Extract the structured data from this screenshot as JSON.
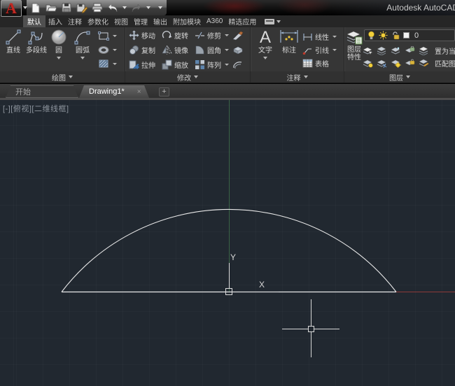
{
  "window": {
    "title": "Autodesk AutoCAD"
  },
  "ribbon_tabs": [
    {
      "label": "默认",
      "active": true
    },
    {
      "label": "插入"
    },
    {
      "label": "注释"
    },
    {
      "label": "参数化"
    },
    {
      "label": "视图"
    },
    {
      "label": "管理"
    },
    {
      "label": "输出"
    },
    {
      "label": "附加模块"
    },
    {
      "label": "A360"
    },
    {
      "label": "精选应用"
    }
  ],
  "draw_panel": {
    "label": "绘图",
    "line": "直线",
    "polyline": "多段线",
    "circle": "圆",
    "arc": "圆弧"
  },
  "modify_panel": {
    "label": "修改",
    "move": "移动",
    "rotate": "旋转",
    "trim": "修剪",
    "copy": "复制",
    "mirror": "镜像",
    "fillet": "圆角",
    "stretch": "拉伸",
    "scale": "缩放",
    "array": "阵列"
  },
  "annotate_panel": {
    "label": "注释",
    "text": "文字",
    "dimension": "标注",
    "linear": "线性",
    "leader": "引线",
    "table": "表格"
  },
  "layers_panel": {
    "label": "图层",
    "properties_line1": "图层",
    "properties_line2": "特性",
    "current_layer": "0",
    "set_current": "置为当前",
    "match_layer": "匹配图层"
  },
  "file_tabs": {
    "start": "开始",
    "drawing": "Drawing1*",
    "close": "×",
    "new_tab": "+"
  },
  "canvas": {
    "viewport_label": "[-][俯视][二维线框]",
    "x_axis_label": "X",
    "y_axis_label": "Y"
  },
  "colors": {
    "canvas_bg": "#212830",
    "x_axis": "#8e3a3a",
    "y_axis": "#3a6346",
    "drawing_line": "#e9e9e9"
  }
}
